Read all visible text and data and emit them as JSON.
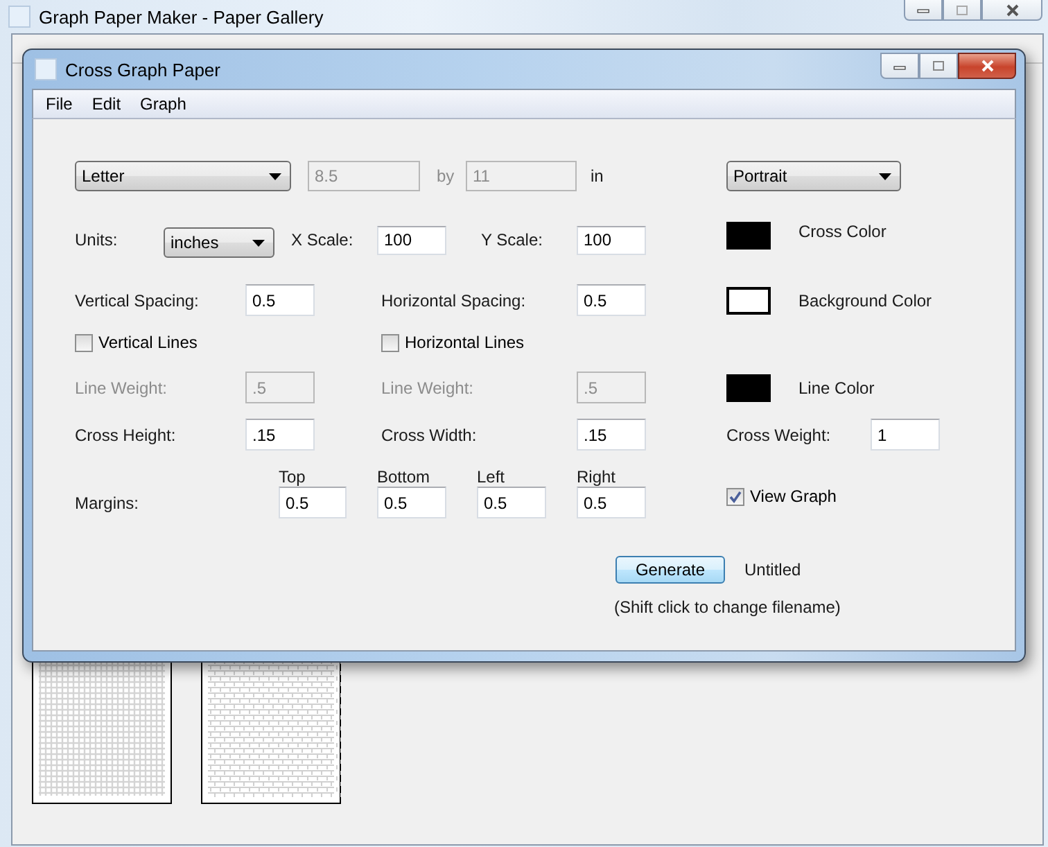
{
  "main_window": {
    "title": "Graph Paper Maker - Paper Gallery",
    "gallery": [
      {
        "kind": "grid"
      },
      {
        "kind": "brick"
      }
    ]
  },
  "dialog": {
    "title": "Cross Graph Paper",
    "menu": [
      "File",
      "Edit",
      "Graph"
    ],
    "paper_size": {
      "value": "Letter"
    },
    "width": {
      "value": "8.5",
      "disabled": true
    },
    "by_label": "by",
    "height": {
      "value": "11",
      "disabled": true
    },
    "unit_label": "in",
    "orientation": {
      "value": "Portrait"
    },
    "units": {
      "label": "Units:",
      "value": "inches"
    },
    "x_scale": {
      "label": "X Scale:",
      "value": "100"
    },
    "y_scale": {
      "label": "Y Scale:",
      "value": "100"
    },
    "colors": [
      {
        "label": "Cross Color",
        "color": "#000000"
      },
      {
        "label": "Background Color",
        "color": "#ffffff"
      },
      {
        "label": "Line Color",
        "color": "#000000"
      }
    ],
    "vertical_spacing": {
      "label": "Vertical Spacing:",
      "value": "0.5"
    },
    "horizontal_spacing": {
      "label": "Horizontal Spacing:",
      "value": "0.5"
    },
    "vertical_lines": {
      "label": "Vertical Lines",
      "checked": false
    },
    "horizontal_lines": {
      "label": "Horizontal Lines",
      "checked": false
    },
    "vertical_line_weight": {
      "label": "Line Weight:",
      "value": ".5",
      "disabled": true
    },
    "horizontal_line_weight": {
      "label": "Line Weight:",
      "value": ".5",
      "disabled": true
    },
    "cross_height": {
      "label": "Cross Height:",
      "value": ".15"
    },
    "cross_width": {
      "label": "Cross Width:",
      "value": ".15"
    },
    "cross_weight": {
      "label": "Cross Weight:",
      "value": "1"
    },
    "margins": {
      "label": "Margins:",
      "fields": [
        {
          "label": "Top",
          "value": "0.5"
        },
        {
          "label": "Bottom",
          "value": "0.5"
        },
        {
          "label": "Left",
          "value": "0.5"
        },
        {
          "label": "Right",
          "value": "0.5"
        }
      ]
    },
    "view_graph": {
      "label": "View Graph",
      "checked": true
    },
    "generate_button": "Generate",
    "filename": "Untitled",
    "hint": "(Shift click to change filename)"
  }
}
